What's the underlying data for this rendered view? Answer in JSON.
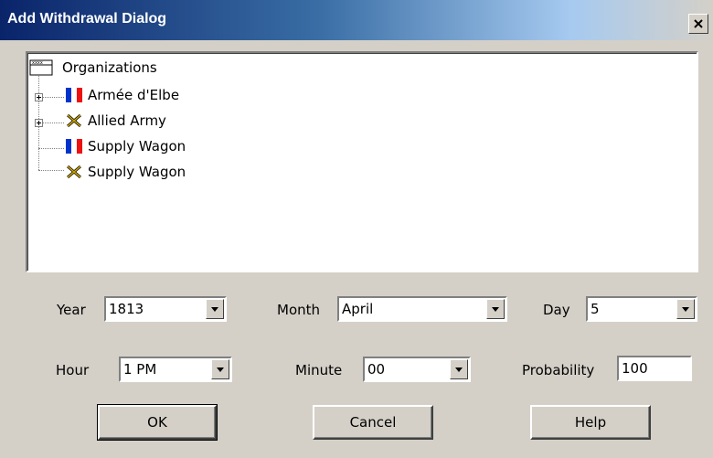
{
  "window": {
    "title": "Add Withdrawal Dialog"
  },
  "tree": {
    "root_label": "Organizations",
    "items": [
      {
        "label": "Armée d'Elbe",
        "icon": "french-flag-icon",
        "expandable": true
      },
      {
        "label": "Allied Army",
        "icon": "allied-crossed-swords-icon",
        "expandable": true
      },
      {
        "label": "Supply Wagon",
        "icon": "french-flag-icon",
        "expandable": false
      },
      {
        "label": "Supply Wagon",
        "icon": "allied-crossed-swords-icon",
        "expandable": false
      }
    ]
  },
  "fields": {
    "year": {
      "label": "Year",
      "value": "1813"
    },
    "month": {
      "label": "Month",
      "value": "April"
    },
    "day": {
      "label": "Day",
      "value": "5"
    },
    "hour": {
      "label": "Hour",
      "value": "1 PM"
    },
    "minute": {
      "label": "Minute",
      "value": "00"
    },
    "probability": {
      "label": "Probability",
      "value": "100"
    }
  },
  "buttons": {
    "ok": "OK",
    "cancel": "Cancel",
    "help": "Help"
  },
  "colors": {
    "title_start": "#0a246a",
    "title_end": "#a6caf0",
    "face": "#d4d0c8",
    "flag_blue": "#0033cc",
    "flag_red": "#ee1111"
  }
}
